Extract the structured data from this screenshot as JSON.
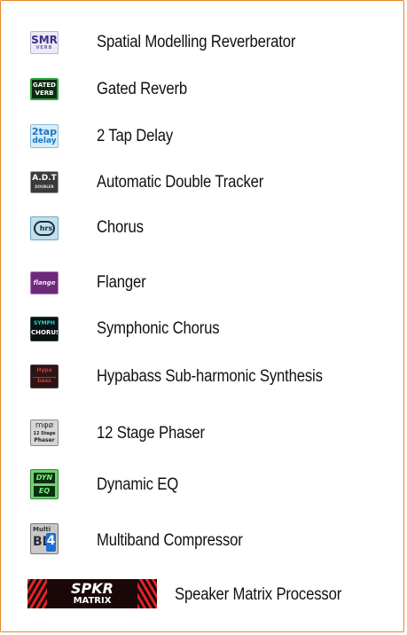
{
  "items": [
    {
      "label": "Spatial Modelling Reverberator",
      "icon": "smr-verb-icon",
      "icon_text": [
        "SMR",
        "VERB"
      ]
    },
    {
      "label": "Gated Reverb",
      "icon": "gated-verb-icon",
      "icon_text": [
        "GATED",
        "VERB"
      ]
    },
    {
      "label": "2 Tap Delay",
      "icon": "2tap-delay-icon",
      "icon_text": [
        "2tap",
        "delay"
      ]
    },
    {
      "label": "Automatic Double Tracker",
      "icon": "adt-doubler-icon",
      "icon_text": [
        "A.D.T",
        "DOUBLER"
      ]
    },
    {
      "label": "Chorus",
      "icon": "chorus-icon",
      "icon_text": [
        "hrs"
      ]
    },
    {
      "label": "Flanger",
      "icon": "flanger-icon",
      "icon_text": [
        "flange"
      ]
    },
    {
      "label": "Symphonic Chorus",
      "icon": "symph-chorus-icon",
      "icon_text": [
        "SYMPH",
        "CHORUS"
      ]
    },
    {
      "label": "Hypabass Sub-harmonic Synthesis",
      "icon": "hypabass-icon",
      "icon_text": [
        "Hypa",
        "bass"
      ]
    },
    {
      "label": "12 Stage Phaser",
      "icon": "phaser-icon",
      "icon_text": [
        "mφø",
        "12 Stage",
        "Phaser"
      ]
    },
    {
      "label": "Dynamic EQ",
      "icon": "dyn-eq-icon",
      "icon_text": [
        "DYN",
        "EQ"
      ]
    },
    {
      "label": "Multiband Compressor",
      "icon": "multiband-icon",
      "icon_text": [
        "Multi",
        "BD",
        "4"
      ]
    },
    {
      "label": "Speaker Matrix Processor",
      "icon": "spkr-matrix-icon",
      "icon_text": [
        "SPKR",
        "MATRIX"
      ]
    }
  ],
  "colors": {
    "border": "#e8862a"
  }
}
